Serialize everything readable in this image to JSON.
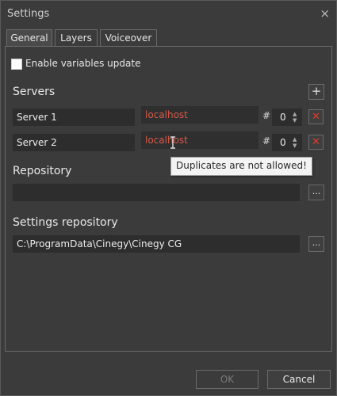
{
  "window": {
    "title": "Settings",
    "close_glyph": "×"
  },
  "tabs": [
    {
      "label": "General",
      "active": true
    },
    {
      "label": "Layers",
      "active": false
    },
    {
      "label": "Voiceover",
      "active": false
    }
  ],
  "general": {
    "enable_variables_update": {
      "label": "Enable variables update",
      "checked": false
    },
    "servers_title": "Servers",
    "add_glyph": "+",
    "hash_label": "#",
    "servers": [
      {
        "name": "Server 1",
        "host": "localhost",
        "port": "0"
      },
      {
        "name": "Server 2",
        "host": "localhost",
        "port": "0"
      }
    ],
    "tooltip": "Duplicates are not allowed!",
    "repository_title": "Repository",
    "repository_value": "",
    "settings_repository_title": "Settings repository",
    "settings_repository_value": "C:\\ProgramData\\Cinegy\\Cinegy CG",
    "browse_glyph": "..."
  },
  "footer": {
    "ok_label": "OK",
    "cancel_label": "Cancel"
  },
  "colors": {
    "error_text": "#d45a4a",
    "delete_icon": "#e33a2a"
  },
  "icons": {
    "delete": "x-icon",
    "add": "plus-icon",
    "browse": "ellipsis-icon"
  }
}
